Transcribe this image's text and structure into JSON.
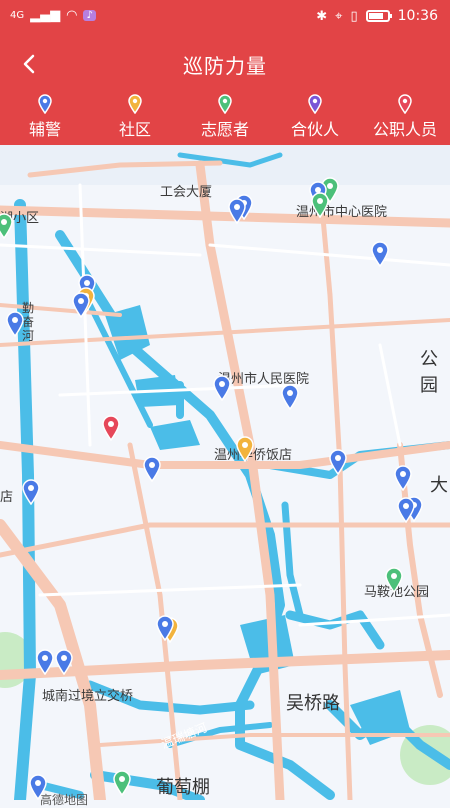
{
  "status_bar": {
    "signal": "4G",
    "time": "10:36"
  },
  "header": {
    "title": "巡防力量",
    "back_icon": "chevron-left-icon"
  },
  "legend": [
    {
      "label": "辅警",
      "color": "#4a7ae6"
    },
    {
      "label": "社区",
      "color": "#f2b33d"
    },
    {
      "label": "志愿者",
      "color": "#4cc07a"
    },
    {
      "label": "合伙人",
      "color": "#7a56d6"
    },
    {
      "label": "公职人员",
      "color": "#e6485a"
    }
  ],
  "map": {
    "labels": [
      "工会大厦",
      "温州市中心医院",
      "湖小区",
      "勤奋河",
      "温州市人民医院",
      "温州华侨饭店",
      "公园",
      "大",
      "马鞍池公园",
      "城南过境立交桥",
      "吴桥路",
      "温瑞塘河",
      "葡萄棚",
      "店",
      "高德地图"
    ],
    "legend_colors": {
      "blue": "#4a7ae6",
      "yellow": "#f2b33d",
      "green": "#4cc07a",
      "red": "#e6485a"
    }
  }
}
